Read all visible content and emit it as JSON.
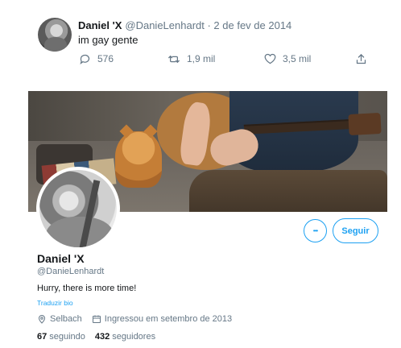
{
  "tweet": {
    "author_name": "Daniel 'X",
    "meta": "@DanieLenhardt · 2 de fev de 2014",
    "text": "im gay gente",
    "reply_count": "576",
    "retweet_count": "1,9 mil",
    "like_count": "3,5 mil"
  },
  "profile": {
    "name": "Daniel 'X",
    "handle": "@DanieLenhardt",
    "bio": "Hurry, there is more time!",
    "translate_label": "Traduzir bio",
    "location": "Selbach",
    "joined": "Ingressou em setembro de 2013",
    "following_count": "67",
    "following_label": "seguindo",
    "followers_count": "432",
    "followers_label": "seguidores",
    "more_label": "•••",
    "follow_label": "Seguir"
  },
  "colors": {
    "accent": "#1da1f2",
    "text_primary": "#14171a",
    "text_secondary": "#657786"
  },
  "icons": {
    "reply": "reply-icon",
    "retweet": "retweet-icon",
    "like": "heart-icon",
    "share": "share-icon",
    "location": "location-pin-icon",
    "calendar": "calendar-icon"
  }
}
